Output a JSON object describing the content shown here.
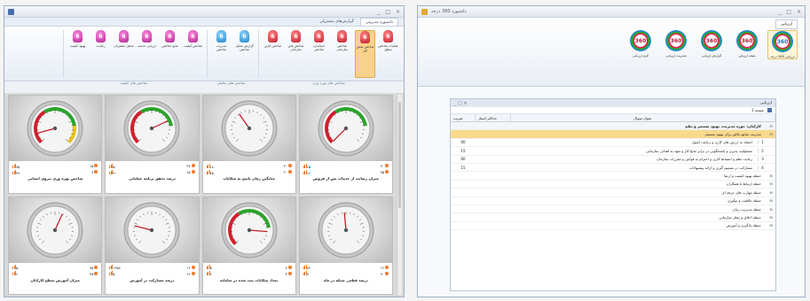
{
  "left": {
    "title": "",
    "window_controls": [
      "_",
      "□",
      "×"
    ],
    "tabs": [
      "داشبورد مدیریتی",
      "گزارش‌های مشتریان"
    ],
    "groups": [
      {
        "title": "شاخص های بهره وری",
        "buttons": [
          {
            "label": "عملیات شاخص سطح",
            "color": "red",
            "selected": false
          },
          {
            "label": "شاخص بخش اول",
            "color": "red",
            "selected": true
          },
          {
            "label": "شاخص سازمانی",
            "color": "red",
            "selected": false
          },
          {
            "label": "استاندارد شاخص",
            "color": "red",
            "selected": false
          },
          {
            "label": "شاخص های سازمانی",
            "color": "red",
            "selected": false
          },
          {
            "label": "شاخص کاری",
            "color": "red",
            "selected": false
          }
        ]
      },
      {
        "title": "شاخص های تحلیلی",
        "buttons": [
          {
            "label": "گزارش تحلیل شاخص",
            "color": "blue",
            "selected": false
          },
          {
            "label": "مدیریت شاخص",
            "color": "blue",
            "selected": false
          }
        ]
      },
      {
        "title": "شاخص های کیفیت",
        "buttons": [
          {
            "label": "شاخص کیفیت",
            "color": "pink",
            "selected": false
          },
          {
            "label": "نتایج شاخص",
            "color": "pink",
            "selected": false
          },
          {
            "label": "ارزیابی خدمت",
            "color": "pink",
            "selected": false
          },
          {
            "label": "تحلیل مشتریان",
            "color": "pink",
            "selected": false
          },
          {
            "label": "رضایت",
            "color": "pink",
            "selected": false
          },
          {
            "label": "بهبود کیفیت",
            "color": "pink",
            "selected": false
          }
        ]
      }
    ],
    "gauges": [
      {
        "title": "میزان رضایت از خدمات پس از فروش",
        "green": true,
        "arc": "rg",
        "s1a": "۶۵",
        "s1b": "۷۰",
        "s2a": "۱۲",
        "s2b": "۹۵"
      },
      {
        "title": "میانگین زمان پاسخ به شکایات",
        "green": false,
        "arc": "none",
        "s1a": "۱۸",
        "s1b": "۳۰",
        "s2a": "۴۵",
        "s2b": "۲۰"
      },
      {
        "title": "درصد تحقق برنامه عملیاتی",
        "green": true,
        "arc": "rg",
        "s1a": "۵۰",
        "s1b": "۴۷",
        "s2a": "۳۰",
        "s2b": "۱۵"
      },
      {
        "title": "شاخص بهره وری نیروی انسانی",
        "green": true,
        "arc": "rgy",
        "s1a": "۷۵",
        "s1b": "۱۵",
        "s2a": "۳۸",
        "s2b": "۷"
      },
      {
        "title": "درصد قطعی شبکه در ماه",
        "green": false,
        "arc": "none",
        "s1a": "۸۲",
        "s1b": "۱۲",
        "s2a": "۷",
        "s2b": "۹۰"
      },
      {
        "title": "تعداد شکایات ثبت شده در سامانه",
        "green": true,
        "arc": "rg",
        "s1a": "۵",
        "s1b": "۴",
        "s2a": "۶",
        "s2b": "۳"
      },
      {
        "title": "درصد مشارکت در آموزش",
        "green": false,
        "arc": "none",
        "s1a": "۱۴۵۷",
        "s1b": "۱۶",
        "s2a": "۵",
        "s2b": "۱۲"
      },
      {
        "title": "میزان آموزش سطح کارکنان",
        "green": false,
        "arc": "none",
        "s1a": "۵",
        "s1b": "۹۵",
        "s2a": "۶",
        "s2b": "۳۵"
      }
    ]
  },
  "right": {
    "title": "داشبورد 360 درجه",
    "window_controls": [
      "_",
      "□",
      "×"
    ],
    "ribbon_tab": "ارزیابی",
    "ribbon_buttons": [
      {
        "label": "ارزیابی 360 درجه",
        "blue": true
      },
      {
        "label": "نتیجه ارزیابی",
        "blue": false
      },
      {
        "label": "گزارش ارزیابی",
        "blue": false
      },
      {
        "label": "مدیریت ارزیابی",
        "blue": false
      },
      {
        "label": "فرم ارزیابی",
        "blue": false
      }
    ],
    "doc": {
      "title": "ارزیابی",
      "page_label": "صفحه 1",
      "headers": [
        "عنوان سوال",
        "حداکثر امتیاز",
        "ضریب"
      ],
      "rows": [
        {
          "type": "group",
          "text": "کارکنان: حوزه مدیریت، بهبود مستمر و نظم",
          "num": ""
        },
        {
          "type": "sel",
          "text": "مدیریت منابع، تلاش برای بهبود مستمر",
          "num": ""
        },
        {
          "type": "item",
          "idx": "1",
          "text": "اعتقاد به ارزش های کاری و رعایت اصول",
          "num": "60"
        },
        {
          "type": "item",
          "idx": "2",
          "text": "مسئولیت پذیری و پاسخگویی در برابر نتایج کار و تعهد به اهداف سازمانی",
          "num": "15"
        },
        {
          "type": "item",
          "idx": "3",
          "text": "رعایت نظم و انضباط کاری و احترام به قوانین و مقررات سازمان",
          "num": "60"
        },
        {
          "type": "item",
          "idx": "4",
          "text": "مشارکت در تصمیم گیری و ارائه پیشنهادات",
          "num": "15"
        },
        {
          "type": "sub",
          "text": "حیطه بهبود کیفیت و ارتقا",
          "num": ""
        },
        {
          "type": "sub",
          "text": "حیطه ارتباط با همکاران",
          "num": ""
        },
        {
          "type": "sub",
          "text": "حیطه مهارت های حرفه ای",
          "num": ""
        },
        {
          "type": "sub",
          "text": "حیطه خلاقیت و نوآوری",
          "num": ""
        },
        {
          "type": "sub",
          "text": "حیطه مدیریت زمان",
          "num": ""
        },
        {
          "type": "sub",
          "text": "حیطه اخلاق و رفتار سازمانی",
          "num": ""
        },
        {
          "type": "sub",
          "text": "حیطه یادگیری و آموزش",
          "num": ""
        }
      ]
    }
  },
  "colors": {
    "lock_red": "#c3182a",
    "lock_pink": "#b0208f",
    "lock_blue": "#1c85c4",
    "selection": "#f9d98c",
    "accent_orange": "#f07a2b"
  }
}
